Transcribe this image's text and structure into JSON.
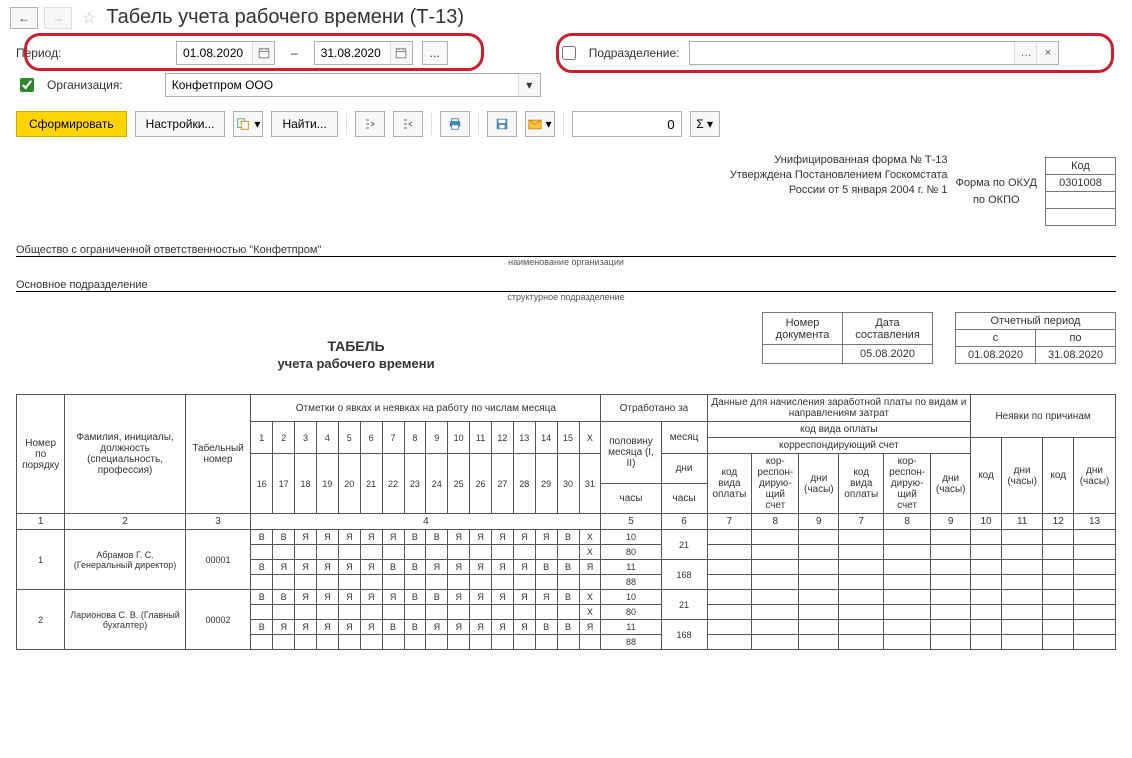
{
  "title": "Табель учета рабочего времени (Т-13)",
  "filters": {
    "period_label": "Период:",
    "date_from": "01.08.2020",
    "date_to": "31.08.2020",
    "dash": "–",
    "department_label": "Подразделение:",
    "department_value": "",
    "org_label": "Организация:",
    "org_value": "Конфетпром ООО",
    "org_checked": true
  },
  "toolbar": {
    "generate": "Сформировать",
    "settings": "Настройки...",
    "find": "Найти...",
    "number_value": "0",
    "ellipsis": "..."
  },
  "report_header": {
    "line1": "Унифицированная форма № Т-13",
    "line2": "Утверждена Постановлением Госкомстата",
    "line3": "России от 5 января 2004 г. № 1",
    "kod_label": "Код",
    "okud_label": "Форма по ОКУД",
    "okud_value": "0301008",
    "okpo_label": "по ОКПО",
    "org_name": "Общество с ограниченной ответственностью \"Конфетпром\"",
    "org_caption": "наименование организации",
    "dept_name": "Основное подразделение",
    "dept_caption": "структурное подразделение"
  },
  "doc_meta": {
    "doc_num_label": "Номер документа",
    "doc_date_label": "Дата составления",
    "doc_date": "05.08.2020",
    "period_label": "Отчетный период",
    "from_label": "с",
    "to_label": "по",
    "from": "01.08.2020",
    "to": "31.08.2020"
  },
  "title_main": "ТАБЕЛЬ",
  "title_sub": "учета  рабочего времени",
  "table_headers": {
    "col1": "Номер по порядку",
    "col2": "Фамилия, инициалы, должность (специальность, профессия)",
    "col3": "Табельный номер",
    "marks": "Отметки о явках и неявках на работу по числам месяца",
    "worked": "Отработано за",
    "half": "половину месяца (I, II)",
    "month": "месяц",
    "days": "дни",
    "hours": "часы",
    "payroll": "Данные для начисления заработной платы по видам и направлениям затрат",
    "pay_code": "код вида оплаты",
    "corr": "корреспондирующий счет",
    "code_col": "код вида оплаты",
    "corr_col": "кор-респон-дирую-щий счет",
    "days_hours": "дни (часы)",
    "absence": "Неявки по причинам",
    "abs_code": "код",
    "abs_dh": "дни (часы)"
  },
  "col_nums": [
    "1",
    "2",
    "3",
    "4",
    "5",
    "6",
    "7",
    "8",
    "9",
    "7",
    "8",
    "9",
    "10",
    "11",
    "12",
    "13"
  ],
  "days_top": [
    "1",
    "2",
    "3",
    "4",
    "5",
    "6",
    "7",
    "8",
    "9",
    "10",
    "11",
    "12",
    "13",
    "14",
    "15",
    "X"
  ],
  "days_bottom": [
    "16",
    "17",
    "18",
    "19",
    "20",
    "21",
    "22",
    "23",
    "24",
    "25",
    "26",
    "27",
    "28",
    "29",
    "30",
    "31"
  ],
  "rows": [
    {
      "num": "1",
      "fio": "Абрамов Г. С. (Генеральный директор)",
      "tab": "00001",
      "marks_r1": [
        "В",
        "В",
        "Я",
        "Я",
        "Я",
        "Я",
        "Я",
        "В",
        "В",
        "Я",
        "Я",
        "Я",
        "Я",
        "Я",
        "В",
        "X"
      ],
      "marks_r2": [
        "",
        "",
        "",
        "",
        "",
        "",
        "",
        "",
        "",
        "",
        "",
        "",
        "",
        "",
        "",
        "X"
      ],
      "marks_r3": [
        "В",
        "Я",
        "Я",
        "Я",
        "Я",
        "Я",
        "В",
        "В",
        "Я",
        "Я",
        "Я",
        "Я",
        "Я",
        "В",
        "В",
        "Я"
      ],
      "marks_r4": [
        "",
        "",
        "",
        "",
        "",
        "",
        "",
        "",
        "",
        "",
        "",
        "",
        "",
        "",
        "",
        ""
      ],
      "half1": "10",
      "half1h": "80",
      "half2": "11",
      "half2h": "88",
      "month_days": "21",
      "month_hours": "168"
    },
    {
      "num": "2",
      "fio": "Ларионова С. В. (Главный бухгалтер)",
      "tab": "00002",
      "marks_r1": [
        "В",
        "В",
        "Я",
        "Я",
        "Я",
        "Я",
        "Я",
        "В",
        "В",
        "Я",
        "Я",
        "Я",
        "Я",
        "Я",
        "В",
        "X"
      ],
      "marks_r2": [
        "",
        "",
        "",
        "",
        "",
        "",
        "",
        "",
        "",
        "",
        "",
        "",
        "",
        "",
        "",
        "X"
      ],
      "marks_r3": [
        "В",
        "Я",
        "Я",
        "Я",
        "Я",
        "Я",
        "В",
        "В",
        "Я",
        "Я",
        "Я",
        "Я",
        "Я",
        "В",
        "В",
        "Я"
      ],
      "marks_r4": [
        "",
        "",
        "",
        "",
        "",
        "",
        "",
        "",
        "",
        "",
        "",
        "",
        "",
        "",
        "",
        ""
      ],
      "half1": "10",
      "half1h": "80",
      "half2": "11",
      "half2h": "88",
      "month_days": "21",
      "month_hours": "168"
    }
  ]
}
